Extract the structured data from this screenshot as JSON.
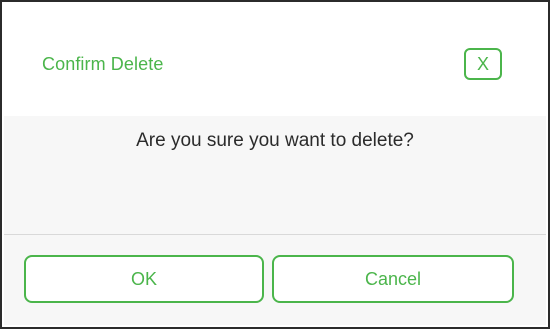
{
  "dialog": {
    "title": "Confirm Delete",
    "close_label": "X",
    "message": "Are you sure you want to delete?",
    "ok_label": "OK",
    "cancel_label": "Cancel"
  },
  "colors": {
    "accent": "#4bb54b",
    "text": "#2b2b2b",
    "body_background": "#f7f7f7",
    "frame": "#2b2b2b"
  }
}
